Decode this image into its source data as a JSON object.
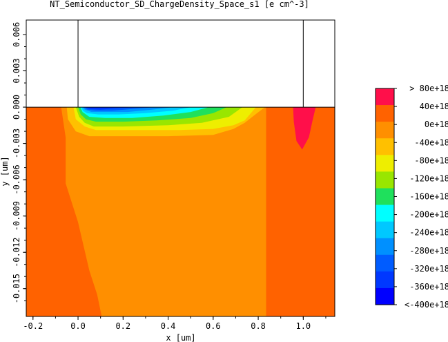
{
  "chart_data": {
    "type": "heatmap",
    "title": "NT_Semiconductor_SD_ChargeDensity_Space_s1 [e cm^-3]",
    "xlabel": "x [um]",
    "ylabel": "y [um]",
    "xlim": [
      -0.23,
      1.14
    ],
    "ylim": [
      -0.0173,
      0.0072
    ],
    "x_ticks": [
      -0.2,
      0.0,
      0.2,
      0.4,
      0.6,
      0.8,
      1.0
    ],
    "x_tick_labels": [
      "-0.2",
      "0.0",
      "0.2",
      "0.4",
      "0.6",
      "0.8",
      "1.0"
    ],
    "y_ticks": [
      0.006,
      0.003,
      0.0,
      -0.003,
      -0.006,
      -0.009,
      -0.012,
      -0.015
    ],
    "y_tick_labels": [
      "0.006",
      "0.003",
      "0.000",
      "-0.003",
      "-0.006",
      "-0.009",
      "-0.012",
      "-0.015"
    ],
    "gate_oxide_region": {
      "x": [
        0.0,
        1.0
      ],
      "y": [
        0.0,
        0.0072
      ]
    },
    "colorbar": {
      "labels": [
        ">  80e+18",
        "40e+18",
        "0e+18",
        "-40e+18",
        "-80e+18",
        "-120e+18",
        "-160e+18",
        "-200e+18",
        "-240e+18",
        "-280e+18",
        "-320e+18",
        "-360e+18",
        "<-400e+18"
      ],
      "colors": [
        "#ff0f4a",
        "#ff6200",
        "#ff8f00",
        "#ffc000",
        "#eeee00",
        "#99e600",
        "#1fe05c",
        "#00ffff",
        "#00c8ff",
        "#0090ff",
        "#005cff",
        "#0038ff",
        "#0000ff"
      ]
    },
    "regions": [
      {
        "level": "40e+18",
        "color": "#ff6200",
        "points": [
          [
            -0.23,
            0.0
          ],
          [
            -0.075,
            0.0
          ],
          [
            -0.055,
            -0.0025
          ],
          [
            -0.055,
            -0.0063
          ],
          [
            0.0,
            -0.0095
          ],
          [
            0.05,
            -0.0135
          ],
          [
            0.085,
            -0.0155
          ],
          [
            0.105,
            -0.0173
          ],
          [
            -0.23,
            -0.0173
          ]
        ]
      },
      {
        "level": "40e+18",
        "color": "#ff6200",
        "points": [
          [
            0.835,
            0.0
          ],
          [
            1.14,
            0.0
          ],
          [
            1.14,
            -0.0173
          ],
          [
            0.835,
            -0.0173
          ]
        ]
      },
      {
        "level": ">  80e+18",
        "color": "#ff0f4a",
        "points": [
          [
            0.955,
            0.0
          ],
          [
            1.055,
            0.0
          ],
          [
            1.04,
            -0.0012
          ],
          [
            1.025,
            -0.0025
          ],
          [
            0.995,
            -0.0035
          ],
          [
            0.97,
            -0.0028
          ],
          [
            0.958,
            -0.0012
          ]
        ]
      },
      {
        "level": "-40e+18",
        "color": "#ffc000",
        "points": [
          [
            -0.05,
            0.0
          ],
          [
            0.83,
            0.0
          ],
          [
            0.795,
            -0.0005
          ],
          [
            0.74,
            -0.0013
          ],
          [
            0.69,
            -0.0018
          ],
          [
            0.6,
            -0.0023
          ],
          [
            0.4,
            -0.0024
          ],
          [
            0.2,
            -0.0024
          ],
          [
            0.05,
            -0.0024
          ],
          [
            -0.01,
            -0.002
          ],
          [
            -0.045,
            -0.001
          ]
        ]
      },
      {
        "level": "-80e+18",
        "color": "#eeee00",
        "points": [
          [
            -0.02,
            0.0
          ],
          [
            0.79,
            0.0
          ],
          [
            0.74,
            -0.0011
          ],
          [
            0.69,
            -0.0015
          ],
          [
            0.6,
            -0.0018
          ],
          [
            0.45,
            -0.0019
          ],
          [
            0.25,
            -0.0019
          ],
          [
            0.08,
            -0.0019
          ],
          [
            0.03,
            -0.0016
          ],
          [
            -0.01,
            -0.001
          ]
        ]
      },
      {
        "level": "-120e+18",
        "color": "#99e600",
        "points": [
          [
            -0.01,
            0.0
          ],
          [
            0.73,
            0.0
          ],
          [
            0.67,
            -0.0008
          ],
          [
            0.55,
            -0.0013
          ],
          [
            0.4,
            -0.0015
          ],
          [
            0.2,
            -0.0016
          ],
          [
            0.07,
            -0.0016
          ],
          [
            0.03,
            -0.0013
          ],
          [
            0.005,
            -0.0008
          ]
        ]
      },
      {
        "level": "-160e+18",
        "color": "#1fe05c",
        "points": [
          [
            0.0,
            0.0
          ],
          [
            0.66,
            0.0
          ],
          [
            0.6,
            -0.0005
          ],
          [
            0.5,
            -0.0009
          ],
          [
            0.35,
            -0.0011
          ],
          [
            0.2,
            -0.0012
          ],
          [
            0.08,
            -0.0012
          ],
          [
            0.035,
            -0.001
          ],
          [
            0.012,
            -0.0006
          ]
        ]
      },
      {
        "level": "-200e+18",
        "color": "#00ffff",
        "points": [
          [
            0.01,
            0.0
          ],
          [
            0.58,
            0.0
          ],
          [
            0.5,
            -0.0004
          ],
          [
            0.38,
            -0.0007
          ],
          [
            0.24,
            -0.0009
          ],
          [
            0.12,
            -0.0009
          ],
          [
            0.05,
            -0.0008
          ],
          [
            0.02,
            -0.0004
          ]
        ]
      },
      {
        "level": "-240e+18",
        "color": "#00c8ff",
        "points": [
          [
            0.015,
            0.0
          ],
          [
            0.5,
            0.0
          ],
          [
            0.42,
            -0.0003
          ],
          [
            0.3,
            -0.0005
          ],
          [
            0.18,
            -0.0006
          ],
          [
            0.09,
            -0.0006
          ],
          [
            0.04,
            -0.0005
          ],
          [
            0.022,
            -0.0003
          ]
        ]
      },
      {
        "level": "-280e+18",
        "color": "#0090ff",
        "points": [
          [
            0.02,
            0.0
          ],
          [
            0.42,
            0.0
          ],
          [
            0.33,
            -0.0002
          ],
          [
            0.22,
            -0.0004
          ],
          [
            0.12,
            -0.0004
          ],
          [
            0.06,
            -0.0004
          ],
          [
            0.03,
            -0.0002
          ]
        ]
      },
      {
        "level": "-320e+18",
        "color": "#005cff",
        "points": [
          [
            0.025,
            0.0
          ],
          [
            0.34,
            0.0
          ],
          [
            0.24,
            -0.00015
          ],
          [
            0.15,
            -0.0003
          ],
          [
            0.08,
            -0.0003
          ],
          [
            0.04,
            -0.0002
          ]
        ]
      },
      {
        "level": "-360e+18",
        "color": "#0038ff",
        "points": [
          [
            0.03,
            0.0
          ],
          [
            0.26,
            0.0
          ],
          [
            0.17,
            -0.0001
          ],
          [
            0.1,
            -0.0002
          ],
          [
            0.05,
            -0.00015
          ]
        ]
      }
    ],
    "background_color": "#ff8f00"
  }
}
